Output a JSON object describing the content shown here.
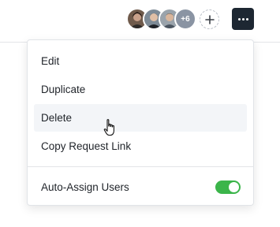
{
  "header": {
    "avatars": [
      {
        "name": "user-1"
      },
      {
        "name": "user-2"
      },
      {
        "name": "user-3"
      }
    ],
    "more_count": "+6",
    "add_user_icon": "plus-icon",
    "more_button_icon": "ellipsis-icon"
  },
  "menu": {
    "items": [
      {
        "label": "Edit"
      },
      {
        "label": "Duplicate"
      },
      {
        "label": "Delete"
      },
      {
        "label": "Copy Request Link"
      }
    ],
    "auto_assign": {
      "label": "Auto-Assign Users",
      "enabled": true
    }
  },
  "colors": {
    "toggle_on": "#3bb54a",
    "more_button_bg": "#1d2732",
    "hover_bg": "#f3f5f8"
  }
}
